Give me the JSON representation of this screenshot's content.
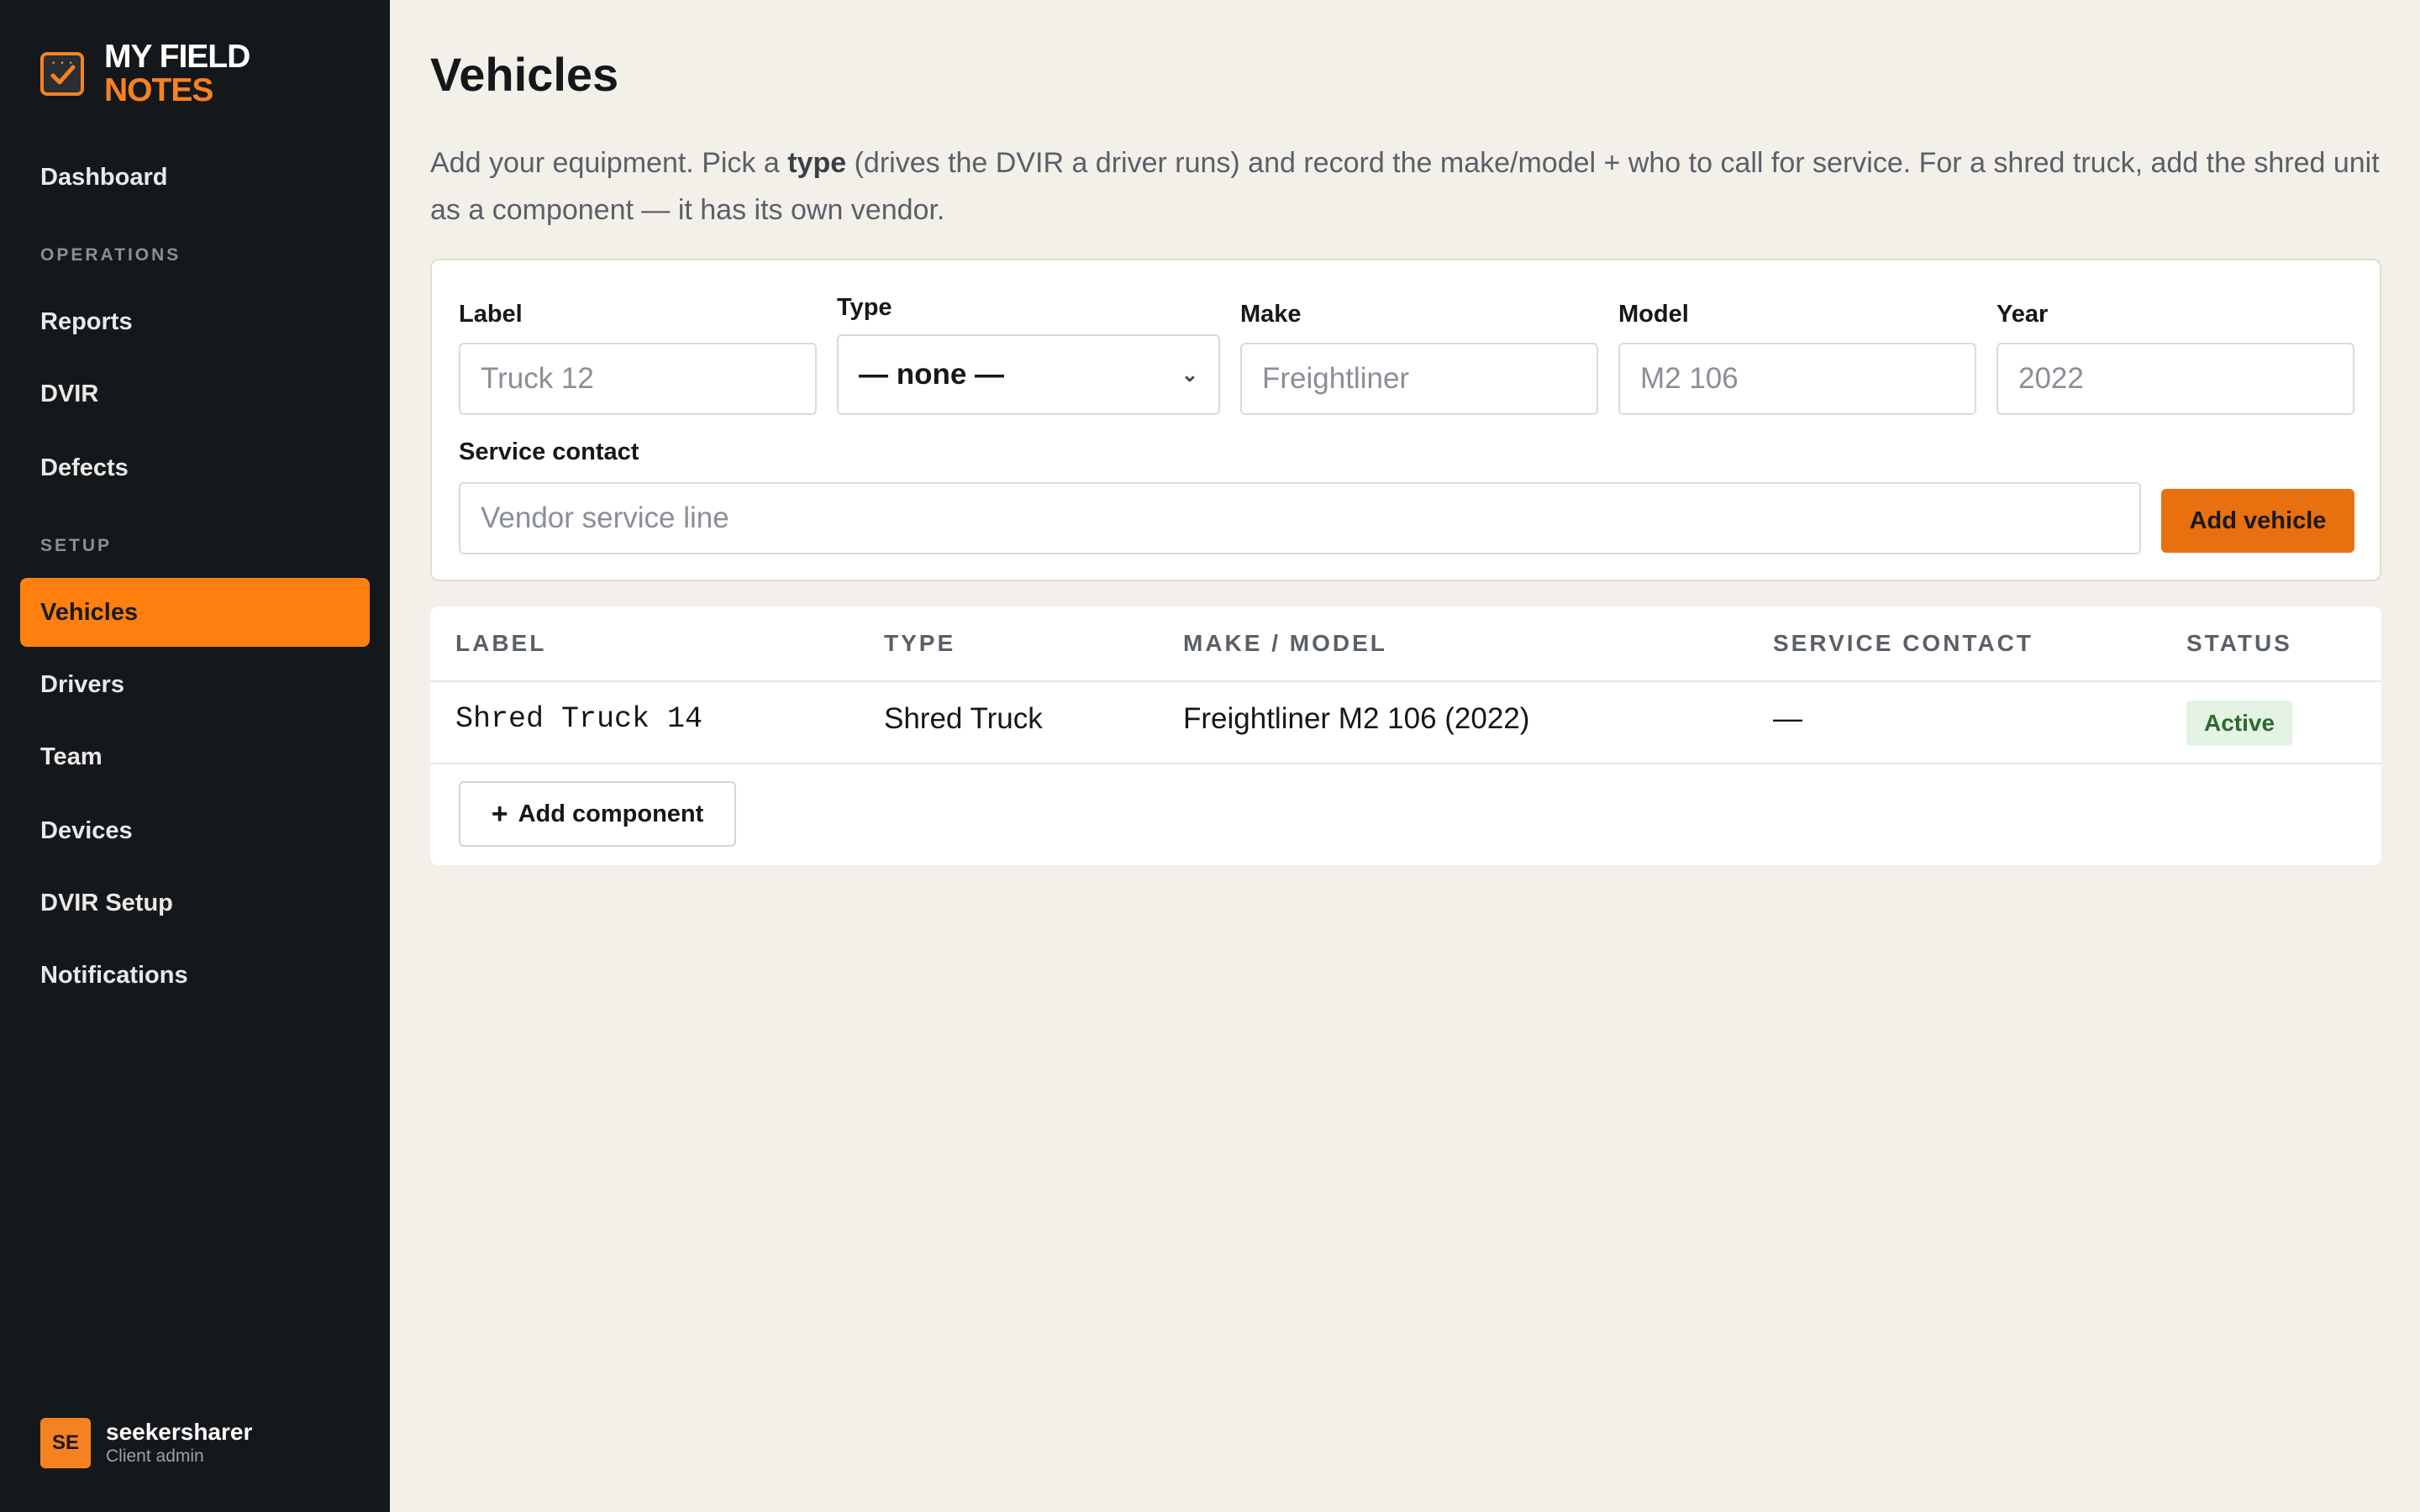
{
  "brand": {
    "line1": "MY FIELD",
    "line2": "NOTES"
  },
  "nav": {
    "dashboard": "Dashboard",
    "section_operations": "OPERATIONS",
    "reports": "Reports",
    "dvir": "DVIR",
    "defects": "Defects",
    "section_setup": "SETUP",
    "vehicles": "Vehicles",
    "drivers": "Drivers",
    "team": "Team",
    "devices": "Devices",
    "dvir_setup": "DVIR Setup",
    "notifications": "Notifications"
  },
  "user": {
    "initials": "SE",
    "name": "seekersharer",
    "role": "Client admin"
  },
  "page": {
    "title": "Vehicles",
    "intro_before": "Add your equipment. Pick a ",
    "intro_bold": "type",
    "intro_after": " (drives the DVIR a driver runs) and record the make/model + who to call for service. For a shred truck, add the shred unit as a component — it has its own vendor."
  },
  "form": {
    "label_label": "Label",
    "label_placeholder": "Truck 12",
    "type_label": "Type",
    "type_value": "— none —",
    "make_label": "Make",
    "make_placeholder": "Freightliner",
    "model_label": "Model",
    "model_placeholder": "M2 106",
    "year_label": "Year",
    "year_placeholder": "2022",
    "service_label": "Service contact",
    "service_placeholder": "Vendor service line",
    "submit_label": "Add vehicle"
  },
  "table": {
    "headers": [
      "LABEL",
      "TYPE",
      "MAKE / MODEL",
      "SERVICE CONTACT",
      "STATUS"
    ],
    "rows": [
      {
        "label": "Shred Truck 14",
        "type": "Shred Truck",
        "make_model": "Freightliner M2 106 (2022)",
        "service_contact": "—",
        "status": "Active"
      }
    ],
    "add_component_label": "Add component"
  },
  "colors": {
    "accent": "#ff7f0f",
    "sidebar_bg": "#15181b",
    "page_bg": "#f3f0ea",
    "status_active_bg": "#e4f3e4",
    "status_active_text": "#2d6a2d"
  }
}
